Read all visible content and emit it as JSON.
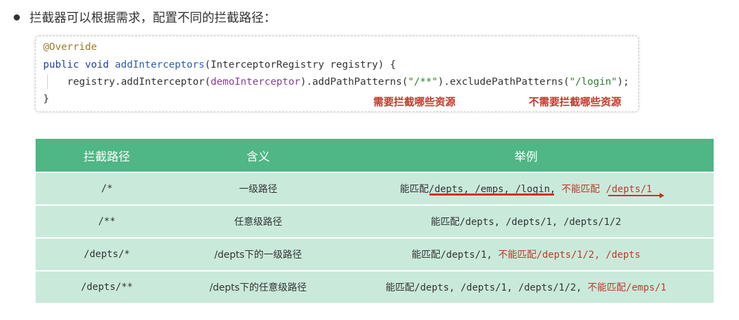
{
  "bullet": {
    "text": "拦截器可以根据需求，配置不同的拦截路径："
  },
  "code": {
    "line1": "@Override",
    "line2_kw": "public void ",
    "line2_fn": "addInterceptors",
    "line2_rest": "(InterceptorRegistry registry) {",
    "line3_a": "registry.addInterceptor(",
    "line3_param": "demoInterceptor",
    "line3_b": ").addPathPatterns(",
    "line3_str1": "\"/**\"",
    "line3_c": ").excludePathPatterns(",
    "line3_str2": "\"/login\"",
    "line3_d": ");",
    "line4": "}",
    "note_include": "需要拦截哪些资源",
    "note_exclude": "不需要拦截哪些资源"
  },
  "table": {
    "headers": [
      "拦截路径",
      "含义",
      "举例"
    ],
    "rows": [
      {
        "path": "/*",
        "meaning": "一级路径",
        "ex_match_label": "能匹配",
        "ex_match": "/depts, /emps, /login",
        "ex_sep": ", ",
        "ex_nomatch_label": "不能匹配",
        "ex_nomatch": "/depts/1"
      },
      {
        "path": "/**",
        "meaning": "任意级路径",
        "ex_match_label": "能匹配",
        "ex_match": "/depts, /depts/1, /depts/1/2"
      },
      {
        "path": "/depts/*",
        "meaning": "/depts下的一级路径",
        "ex_match_label": "能匹配",
        "ex_match": "/depts/1, ",
        "ex_nomatch_label": "不能匹配",
        "ex_nomatch": "/depts/1/2, /depts"
      },
      {
        "path": "/depts/**",
        "meaning": "/depts下的任意级路径",
        "ex_match_label": "能匹配",
        "ex_match": "/depts, /depts/1, /depts/1/2, ",
        "ex_nomatch_label": "不能匹配",
        "ex_nomatch": "/emps/1"
      }
    ]
  },
  "colors": {
    "header_bg": "#4fb685",
    "row_bg": "#c9eadb",
    "accent_red": "#c0392b"
  }
}
